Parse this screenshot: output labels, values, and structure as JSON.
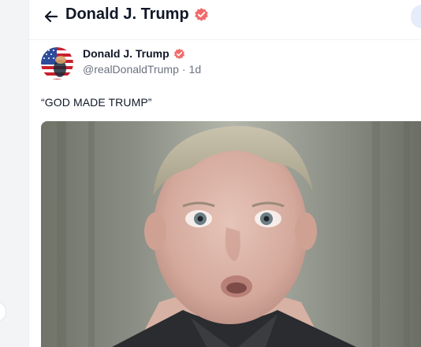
{
  "header": {
    "title": "Donald J. Trump",
    "back_icon": "arrow-left-icon",
    "verified_icon": "verified-badge-icon"
  },
  "post": {
    "author_name": "Donald J. Trump",
    "handle": "@realDonaldTrump",
    "separator": "·",
    "time": "1d",
    "text": "“GOD MADE TRUMP”",
    "avatar_icon": "american-flag-avatar",
    "media": "photo of a young boy"
  },
  "colors": {
    "verified": "#f16b6b",
    "title": "#111827",
    "meta": "#6b7280",
    "accent_blob": "#e7ecfb"
  }
}
